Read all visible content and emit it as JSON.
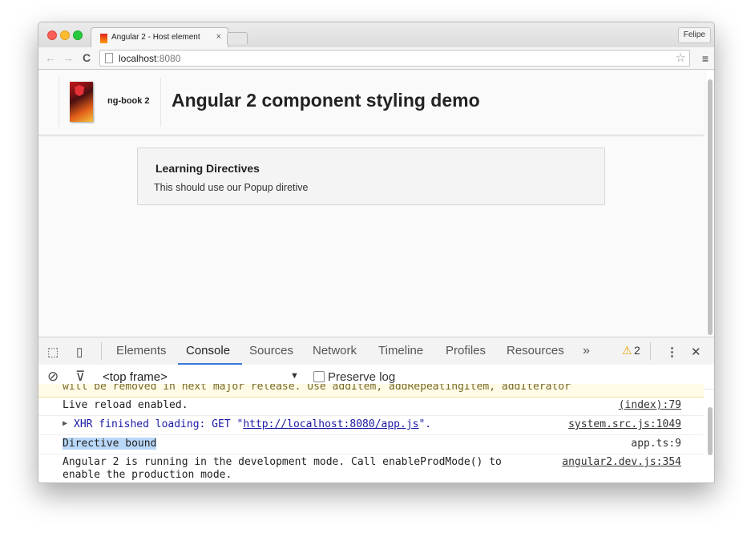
{
  "browser": {
    "tab_title": "Angular 2 - Host element",
    "tab_close": "×",
    "profile_name": "Felipe",
    "url_host": "localhost",
    "url_port": ":8080",
    "back_icon": "←",
    "forward_icon": "→",
    "reload_icon": "C",
    "star_icon": "☆",
    "menu_icon": "≡"
  },
  "page": {
    "brand_name": "ng-book 2",
    "title": "Angular 2 component styling demo",
    "card_title": "Learning Directives",
    "card_text": "This should use our Popup diretive"
  },
  "devtools": {
    "tabs": [
      "Elements",
      "Console",
      "Sources",
      "Network",
      "Timeline",
      "Profiles",
      "Resources"
    ],
    "active_tab": "Console",
    "more_icon": "»",
    "warning_icon": "⚠",
    "warning_count": "2",
    "kebab_icon": "⋮",
    "close_icon": "✕",
    "clear_icon": "⊘",
    "filter_icon": "⊽",
    "frame_select": "<top frame>",
    "dropdown_arrow": "▼",
    "preserve_log_label": "Preserve log",
    "preserve_log_checked": false
  },
  "console": {
    "partial_line": "will be removed in next major release. Use addItem, addRepeatingItem, addIterator",
    "rows": [
      {
        "message": "Live reload enabled.",
        "source": "(index):79"
      },
      {
        "prefix": "▶",
        "message_pre": "XHR finished loading: GET \"",
        "url": "http://localhost:8080/app.js",
        "message_post": "\".",
        "source": "system.src.js:1049"
      },
      {
        "message": "Directive bound",
        "source": "app.ts:9"
      },
      {
        "message_line1": "Angular 2 is running in the development mode. Call enableProdMode() to",
        "message_line2": "enable the production mode.",
        "source": "angular2.dev.js:354"
      }
    ]
  }
}
